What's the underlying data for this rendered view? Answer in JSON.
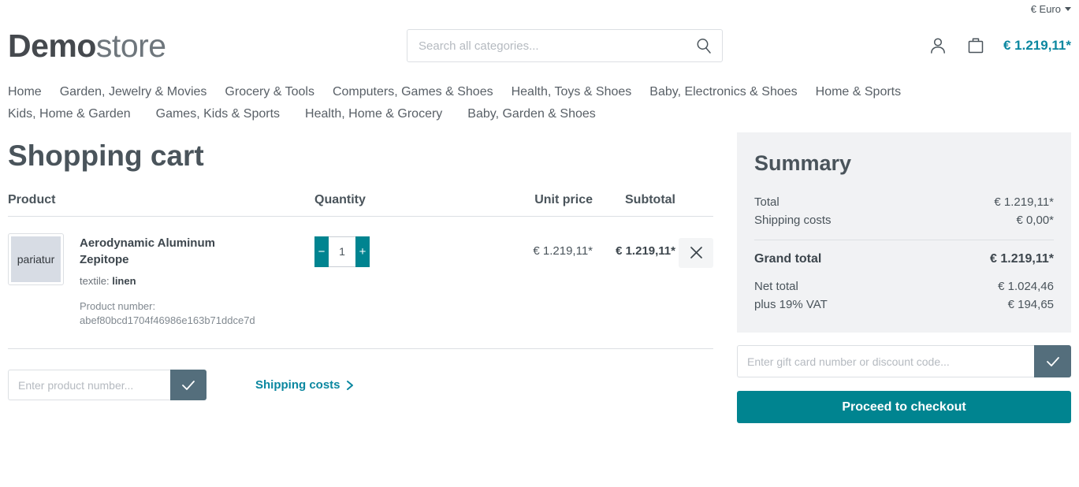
{
  "topbar": {
    "currency_label": "€ Euro"
  },
  "header": {
    "logo_bold": "Demo",
    "logo_light": "store",
    "search_placeholder": "Search all categories...",
    "search_value": "",
    "cart_total": "€ 1.219,11*"
  },
  "nav": {
    "row1": [
      "Home",
      "Garden, Jewelry & Movies",
      "Grocery & Tools",
      "Computers, Games & Shoes",
      "Health, Toys & Shoes",
      "Baby, Electronics & Shoes",
      "Home & Sports"
    ],
    "row2": [
      "Kids, Home & Garden",
      "Games, Kids & Sports",
      "Health, Home & Grocery",
      "Baby, Garden & Shoes"
    ]
  },
  "cart": {
    "page_title": "Shopping cart",
    "columns": {
      "product": "Product",
      "quantity": "Quantity",
      "unit_price": "Unit price",
      "subtotal": "Subtotal"
    },
    "items": [
      {
        "thumb_text": "pariatur",
        "name": "Aerodynamic Aluminum Zepitope",
        "variant_label": "textile:",
        "variant_value": "linen",
        "product_number_label": "Product number:",
        "product_number": "abef80bcd1704f46986e163b71ddce7d",
        "quantity": "1",
        "decrease_label": "−",
        "increase_label": "+",
        "unit_price": "€ 1.219,11*",
        "subtotal": "€ 1.219,11*"
      }
    ],
    "product_number_placeholder": "Enter product number...",
    "product_number_value": "",
    "shipping_costs_link": "Shipping costs"
  },
  "summary": {
    "title": "Summary",
    "rows": [
      {
        "label": "Total",
        "value": "€ 1.219,11*"
      },
      {
        "label": "Shipping costs",
        "value": "€ 0,00*"
      }
    ],
    "grand_total": {
      "label": "Grand total",
      "value": "€ 1.219,11*"
    },
    "tax_rows": [
      {
        "label": "Net total",
        "value": "€ 1.024,46"
      },
      {
        "label": "plus 19% VAT",
        "value": "€ 194,65"
      }
    ],
    "discount_placeholder": "Enter gift card number or discount code...",
    "discount_value": "",
    "checkout_label": "Proceed to checkout"
  },
  "colors": {
    "accent_teal": "#008490",
    "link_teal": "#0b87a0",
    "slate": "#546e7c",
    "panel_bg": "#f1f2f4",
    "text": "#4a545b"
  }
}
